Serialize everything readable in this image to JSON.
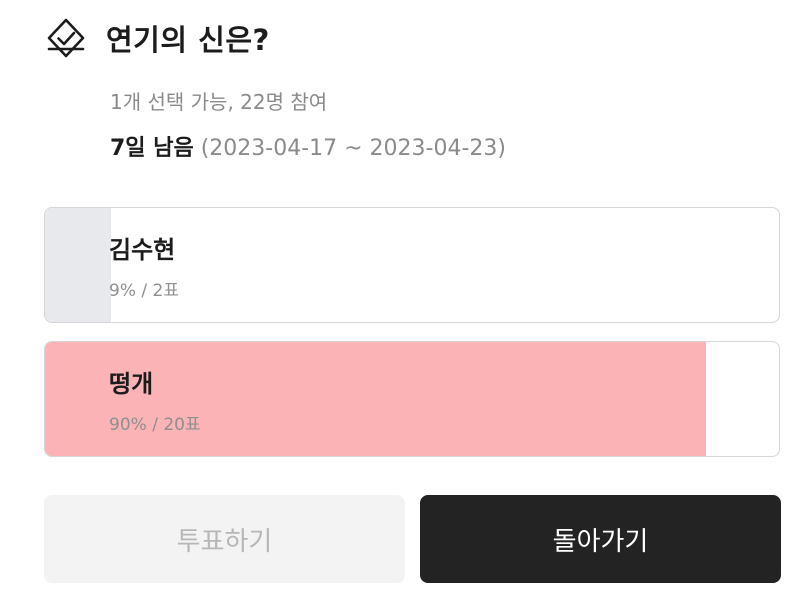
{
  "poll": {
    "title": "연기의 신은?",
    "title_icon": "ballot-check-icon",
    "info": "1개 선택 가능, 22명 참여",
    "deadline": {
      "remaining": "7일 남음",
      "range": "(2023-04-17 ~ 2023-04-23)"
    },
    "options": [
      {
        "label": "김수현",
        "stat": "9% / 2표",
        "percent": 9,
        "fill_color": "#e8e9ec"
      },
      {
        "label": "떵개",
        "stat": "90% / 20표",
        "percent": 90,
        "fill_color": "#fbb3b6"
      }
    ],
    "buttons": {
      "vote_label": "투표하기",
      "back_label": "돌아가기"
    }
  }
}
